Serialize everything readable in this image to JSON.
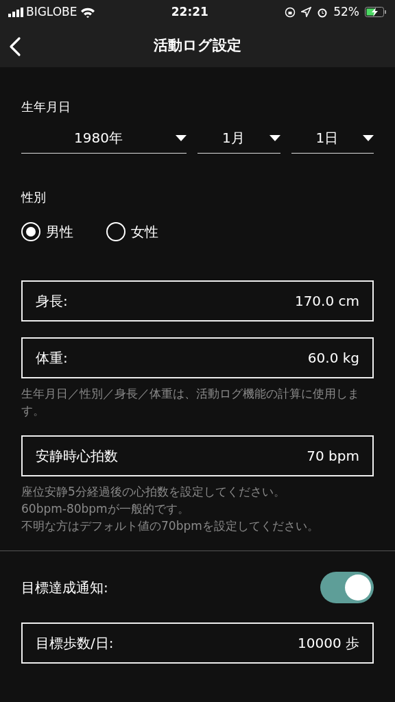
{
  "status_bar": {
    "carrier": "BIGLOBE",
    "time": "22:21",
    "battery": "52%"
  },
  "nav": {
    "title": "活動ログ設定"
  },
  "birthdate": {
    "label": "生年月日",
    "selects": [
      {
        "value": "1980年"
      },
      {
        "value": "1月"
      },
      {
        "value": "1日"
      }
    ]
  },
  "gender": {
    "label": "性別",
    "options": [
      {
        "label": "男性",
        "selected": true
      },
      {
        "label": "女性",
        "selected": false
      }
    ]
  },
  "items": [
    {
      "kind": "field",
      "label": "身長:",
      "value": "170.0 cm"
    },
    {
      "kind": "field",
      "label": "体重:",
      "value": "60.0 kg"
    },
    {
      "kind": "note",
      "lines": [
        "生年月日／性別／身長／体重は、活動ログ機能の計算に使用します。"
      ]
    },
    {
      "kind": "field",
      "label": "安静時心拍数",
      "value": "70 bpm"
    },
    {
      "kind": "note",
      "lines": [
        "座位安静5分経過後の心拍数を設定してください。",
        "60bpm-80bpmが一般的です。",
        "不明な方はデフォルト値の70bpmを設定してください。"
      ]
    },
    {
      "kind": "divider"
    },
    {
      "kind": "toggle",
      "label": "目標達成通知:",
      "on": true
    },
    {
      "kind": "field",
      "label": "目標歩数/日:",
      "value": "10000 歩"
    }
  ]
}
